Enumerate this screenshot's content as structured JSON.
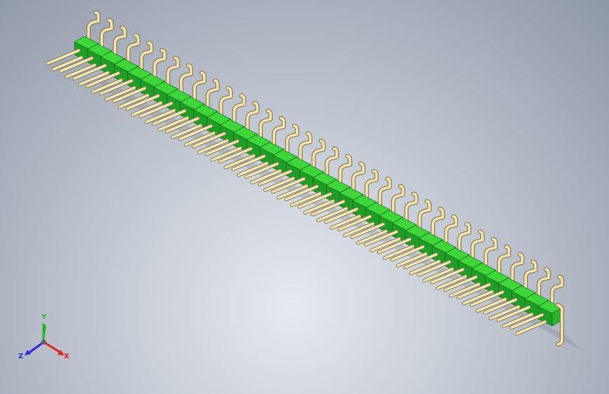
{
  "model": {
    "pin_count": 36,
    "rows": 2,
    "housing_color": "#3fd63a",
    "housing_dark": "#1f9e27",
    "pin_color": "#f1e5b6",
    "pin_dark": "#8a7a45"
  },
  "triad": {
    "x_label": "X",
    "y_label": "Y",
    "z_label": "Z",
    "x_color": "#e02020",
    "y_color": "#22b522",
    "z_color": "#2a2ad8"
  }
}
